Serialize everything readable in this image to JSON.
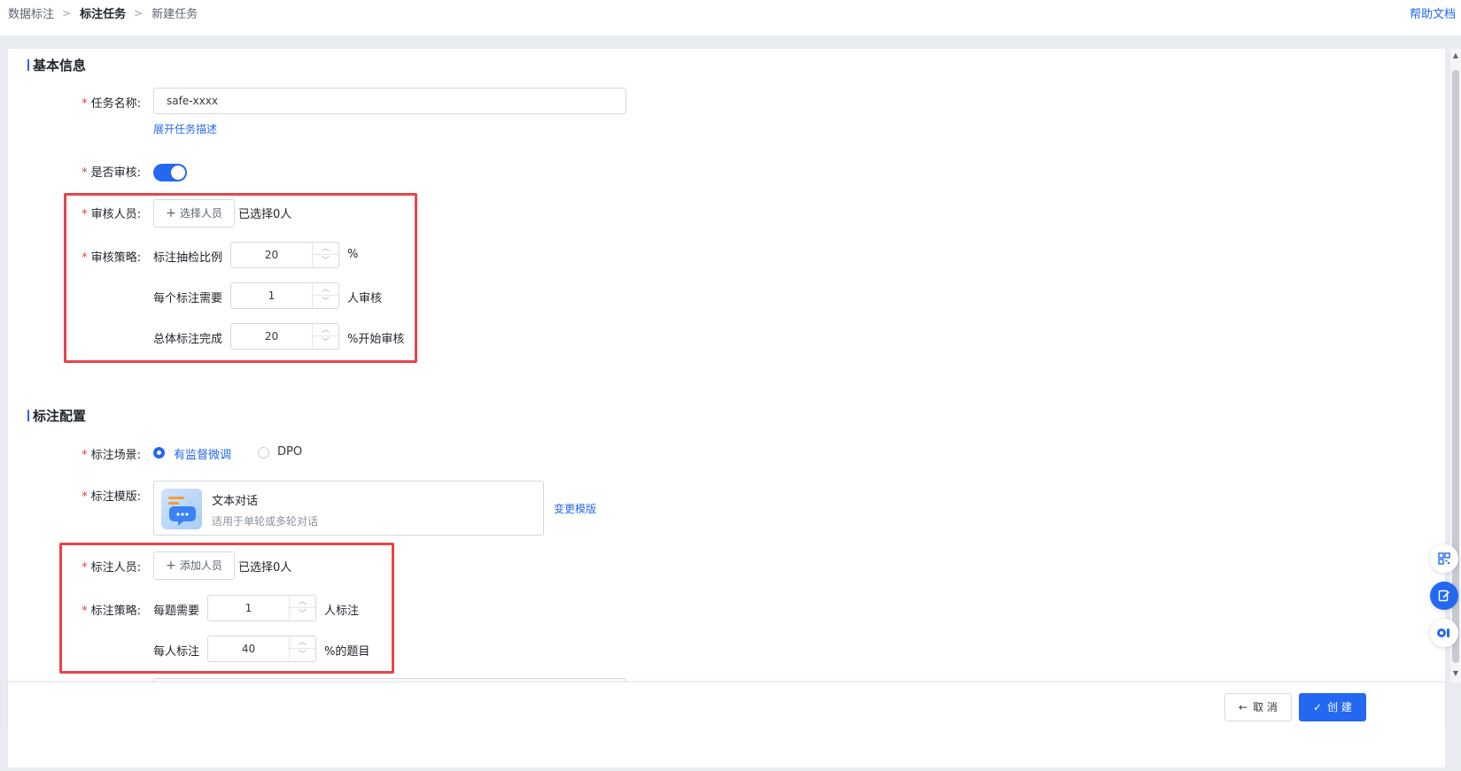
{
  "breadcrumb": {
    "items": [
      "数据标注",
      "标注任务",
      "新建任务"
    ],
    "separator": ">"
  },
  "help_link": "帮助文档",
  "basic_info": {
    "title": "基本信息",
    "task_name": {
      "label": "任务名称:",
      "value": "safe-xxxx"
    },
    "expand_desc": "展开任务描述",
    "review_enabled": {
      "label": "是否审核:",
      "state": true
    },
    "reviewers": {
      "label": "审核人员:",
      "button": "选择人员",
      "selected": "已选择0人"
    },
    "review_strategy": {
      "label": "审核策略:",
      "rows": [
        {
          "prefix": "标注抽检比例",
          "value": "20",
          "suffix": "%"
        },
        {
          "prefix": "每个标注需要",
          "value": "1",
          "suffix": "人审核"
        },
        {
          "prefix": "总体标注完成",
          "value": "20",
          "suffix": "%开始审核"
        }
      ]
    }
  },
  "label_config": {
    "title": "标注配置",
    "scene": {
      "label": "标注场景:",
      "options": [
        "有监督微调",
        "DPO"
      ],
      "selected": "有监督微调"
    },
    "template": {
      "label": "标注模版:",
      "name": "文本对话",
      "desc": "适用于单轮或多轮对话",
      "change": "变更模版"
    },
    "labelers": {
      "label": "标注人员:",
      "button": "添加人员",
      "selected": "已选择0人"
    },
    "label_strategy": {
      "label": "标注策略:",
      "rows": [
        {
          "prefix": "每题需要",
          "value": "1",
          "suffix": "人标注"
        },
        {
          "prefix": "每人标注",
          "value": "40",
          "suffix": "%的题目"
        }
      ]
    }
  },
  "footer": {
    "cancel": "取 消",
    "create": "创 建"
  },
  "side_tools": [
    "qr-code-icon",
    "edit-icon",
    "ai-icon"
  ],
  "colors": {
    "accent": "#2468f2",
    "highlight_box": "#e8434b",
    "required": "#e23d3d"
  }
}
